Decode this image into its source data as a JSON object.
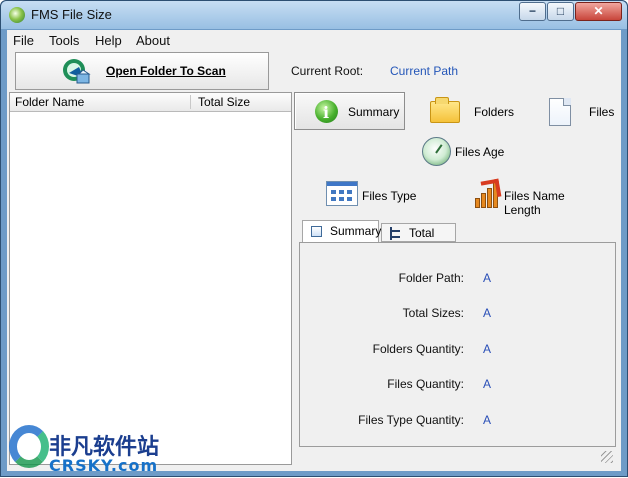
{
  "window": {
    "title": "FMS File Size",
    "controls": {
      "minimize": "−",
      "maximize": "□",
      "close": "✕"
    }
  },
  "menu": {
    "items": [
      "File",
      "Tools",
      "Help",
      "About"
    ]
  },
  "toolbar": {
    "open_folder_label": "Open Folder To Scan",
    "current_root_label": "Current Root:",
    "current_root_value": "Current Path"
  },
  "tree": {
    "columns": [
      "Folder Name",
      "Total Size"
    ]
  },
  "views": {
    "summary": "Summary",
    "folders": "Folders",
    "files": "Files",
    "files_age": "Files Age",
    "files_type": "Files Type",
    "files_name_length": "Files Name Length"
  },
  "tabs": [
    "Summary",
    "Total List"
  ],
  "summary": {
    "folder_path_label": "Folder Path:",
    "folder_path_value": "A",
    "total_sizes_label": "Total Sizes:",
    "total_sizes_value": "A",
    "folders_quantity_label": "Folders Quantity:",
    "folders_quantity_value": "A",
    "files_quantity_label": "Files Quantity:",
    "files_quantity_value": "A",
    "files_type_quantity_label": "Files Type Quantity:",
    "files_type_quantity_value": "A"
  },
  "watermark": {
    "cn": "非凡软件站",
    "en": "CRSKY.com"
  },
  "colors": {
    "window_frame": "#6e9bc7",
    "link_blue": "#2456b8",
    "value_blue": "#2a4fb7"
  },
  "icons": {
    "app": "app-icon",
    "open_folder": "folder-scan-icon",
    "summary": "info-icon",
    "folders": "folder-icon",
    "files": "file-icon",
    "files_age": "clock-icon",
    "files_type": "grid-icon",
    "files_name_length": "chart-icon"
  }
}
